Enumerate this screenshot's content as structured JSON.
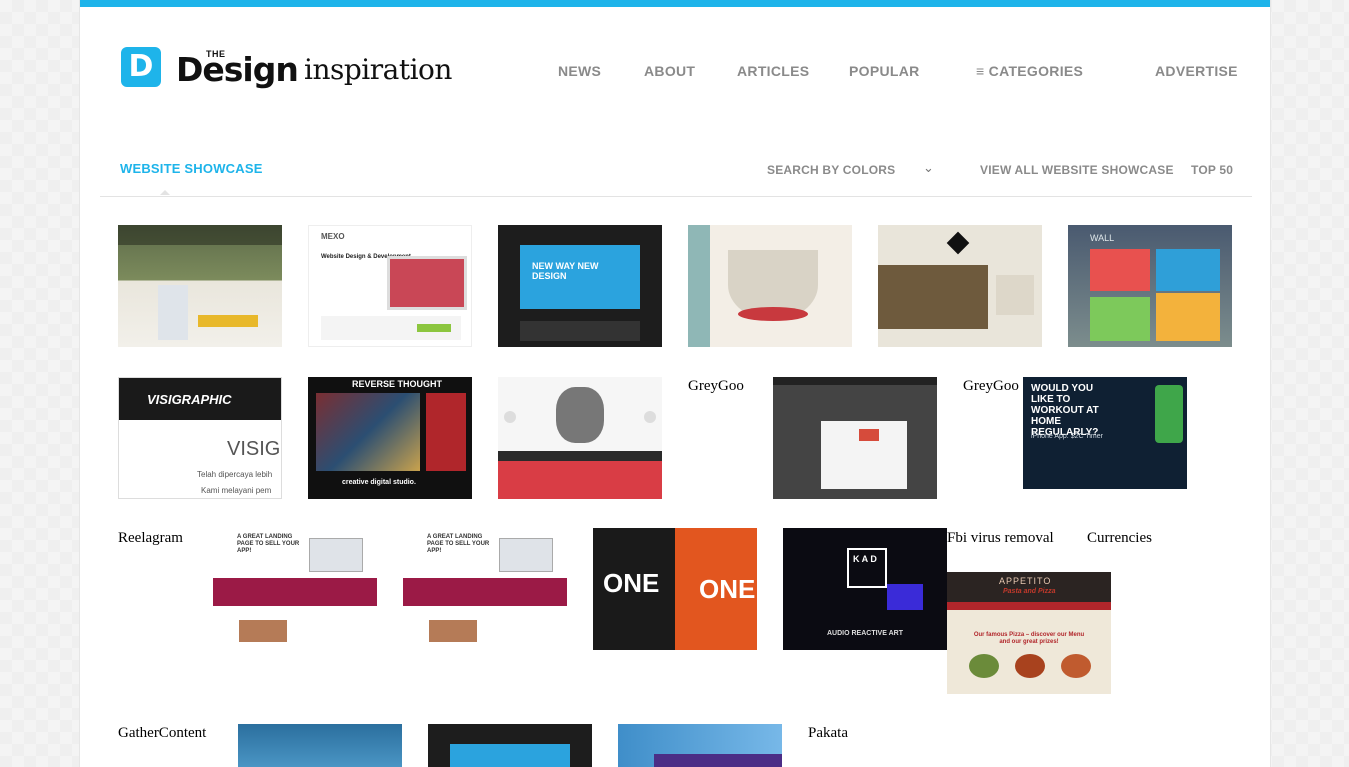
{
  "brand": {
    "logo_letter": "D",
    "logo_the": "THE",
    "logo_design": "Design",
    "logo_inspiration": "inspiration",
    "accent_color": "#1eb4ea"
  },
  "nav": {
    "news": "NEWS",
    "about": "ABOUT",
    "articles": "ARTICLES",
    "popular": "POPULAR",
    "categories": "≡ CATEGORIES",
    "advertise": "ADVERTISE"
  },
  "subnav": {
    "title": "WEBSITE SHOWCASE",
    "search_colors": "SEARCH BY COLORS",
    "chevron_icon": "chevron-down-icon",
    "view_all": "VIEW ALL WEBSITE SHOWCASE",
    "top50": "TOP 50"
  },
  "labels": {
    "greygoo_1": "GreyGoo",
    "greygoo_2": "GreyGoo",
    "reelagram": "Reelagram",
    "fbi": "Fbi virus removal",
    "currencies": "Currencies",
    "gathercontent": "GatherContent",
    "pakata": "Pakata"
  },
  "thumbs": {
    "wall": "WALL",
    "mexo": "MEXO",
    "mexo_heading": "Website Design & Development",
    "kymbo_hero": "NEW WAY NEW DESIGN",
    "visigraphic": "VISIGRAPHIC",
    "visigraphic_sub": "VISIGR",
    "visigraphic_text1": "Telah dipercaya lebih",
    "visigraphic_text2": "Kami melayani pem",
    "reverse": "REVERSE THOUGHT",
    "reverse_creative": "creative digital studio.",
    "workout": "WOULD YOU LIKE TO WORKOUT AT HOME REGULARLY?",
    "workout_sub": "iPhone App: $2C Timer",
    "landing": "A GREAT LANDING PAGE TO SELL YOUR APP!",
    "one_left": "ONE",
    "one_right": "ONE",
    "kad": "K A D",
    "kad_sub": "AUDIO REACTIVE ART",
    "appetito": "APPETITO",
    "appetito_sub": "Pasta and Pizza",
    "pizza": "Our famous Pizza – discover our Menu and our great prizes!"
  }
}
